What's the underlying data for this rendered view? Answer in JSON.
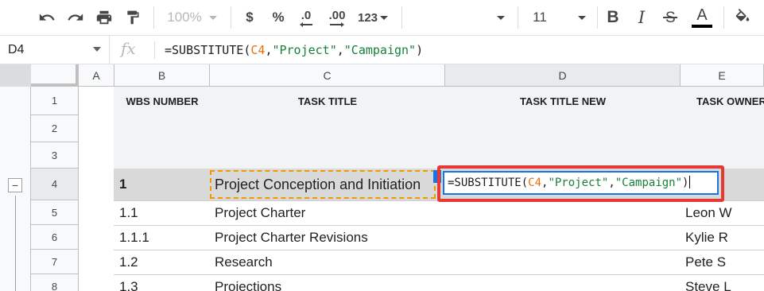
{
  "toolbar": {
    "zoom": "100%",
    "currency": "$",
    "percent": "%",
    "decrease_decimal": ".0",
    "increase_decimal": ".00",
    "more_formats": "123",
    "font_size": "11",
    "bold": "B",
    "italic": "I",
    "text_color": "A",
    "icons": [
      "undo-icon",
      "redo-icon",
      "print-icon",
      "paint-format-icon",
      "bold-icon",
      "italic-icon",
      "strikethrough-icon",
      "text-color-icon",
      "fill-color-icon"
    ]
  },
  "formula_bar": {
    "cell_ref": "D4",
    "fx_label": "fx",
    "formula_prefix": "=SUBSTITUTE(",
    "formula_ref": "C4",
    "formula_sep1": ",",
    "formula_arg1": "\"Project\"",
    "formula_sep2": ",",
    "formula_arg2": "\"Campaign\"",
    "formula_suffix": ")"
  },
  "columns": [
    "A",
    "B",
    "C",
    "D",
    "E"
  ],
  "selected_column": "D",
  "header_row": {
    "b": "WBS NUMBER",
    "c": "TASK TITLE",
    "d": "TASK TITLE NEW",
    "e": "TASK OWNER"
  },
  "rows": [
    {
      "num": "1"
    },
    {
      "num": "2"
    },
    {
      "num": "3"
    },
    {
      "num": "4",
      "b": "1",
      "c": "Project Conception and Initiation",
      "e": ""
    },
    {
      "num": "5",
      "b": "1.1",
      "c": "Project Charter",
      "e": "Leon W"
    },
    {
      "num": "6",
      "b": "1.1.1",
      "c": "Project Charter Revisions",
      "e": "Kylie R"
    },
    {
      "num": "7",
      "b": "1.2",
      "c": "Research",
      "e": "Pete S"
    },
    {
      "num": "8",
      "b": "1.3",
      "c": "Projections",
      "e": "Steve L"
    }
  ],
  "group_toggle": "−",
  "colors": {
    "selection_blue": "#1a73e8",
    "copy_orange": "#f29900",
    "annotation_red": "#e53935",
    "ref_orange": "#e8710a",
    "string_green": "#188038"
  }
}
